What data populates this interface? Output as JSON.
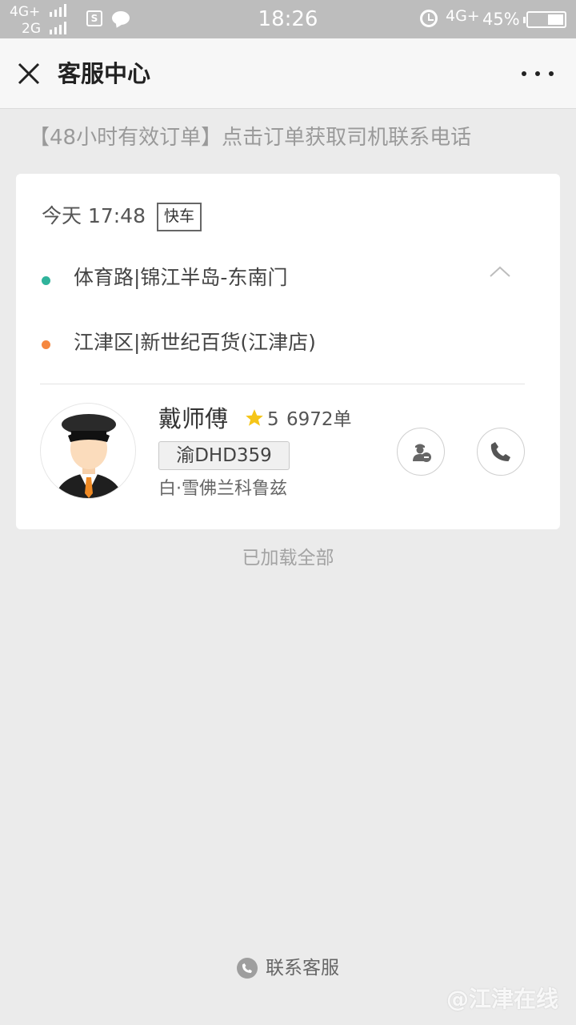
{
  "status_bar": {
    "network_1": "4G+",
    "network_2": "2G",
    "time": "18:26",
    "network_right": "4G+",
    "battery_percent": "45%",
    "battery_level": 0.45
  },
  "title_bar": {
    "title": "客服中心",
    "close_icon": "close-icon",
    "more_icon": "more-icon"
  },
  "notice": "【48小时有效订单】点击订单获取司机联系电话",
  "order": {
    "time": "今天 17:48",
    "car_type": "快车",
    "start_address": "体育路|锦江半岛-东南门",
    "end_address": "江津区|新世纪百货(江津店)",
    "start_color": "#2fb39b",
    "end_color": "#f5873f",
    "driver": {
      "name": "戴师傅",
      "rating": "5",
      "orders": "6972单",
      "plate": "渝DHD359",
      "car_model": "白·雪佛兰科鲁兹"
    }
  },
  "loaded_text": "已加载全部",
  "contact_label": "联系客服",
  "watermark": "@江津在线"
}
